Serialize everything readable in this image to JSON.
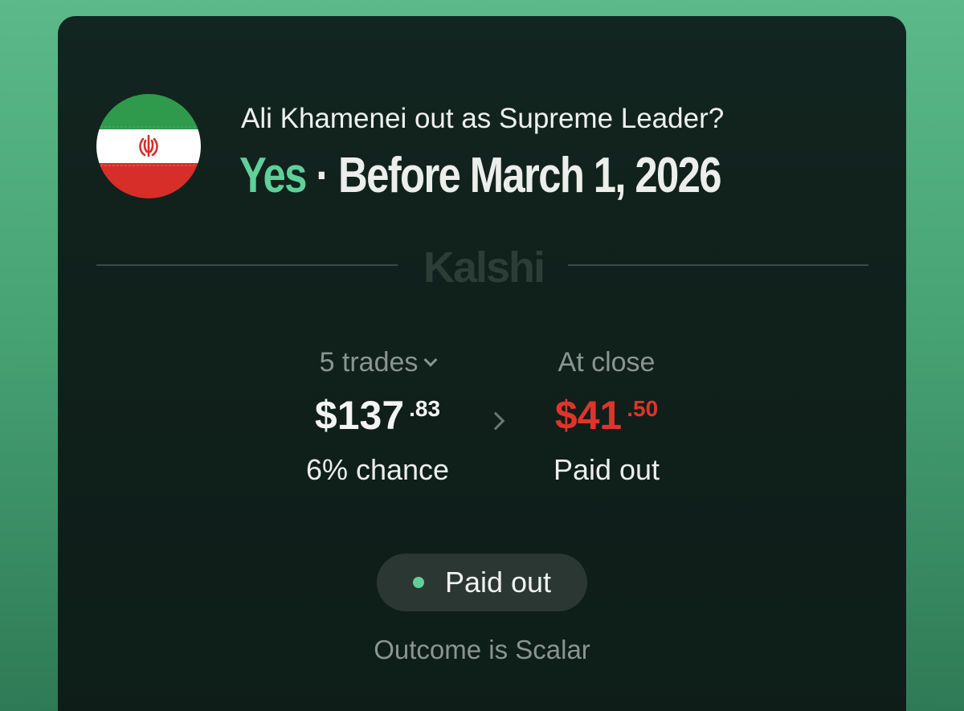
{
  "market": {
    "question": "Ali Khamenei out as Supreme Leader?",
    "side": "Yes",
    "separator": "·",
    "outcome_label": "Before March 1, 2026",
    "flag_icon": "iran-flag-icon"
  },
  "brand": {
    "name": "Kalshi"
  },
  "trades": {
    "label": "5 trades",
    "amount_main": "$137",
    "amount_cents": ".83",
    "chance": "6% chance"
  },
  "close": {
    "label": "At close",
    "amount_main": "$41",
    "amount_cents": ".50",
    "status": "Paid out"
  },
  "status_pill": {
    "text": "Paid out",
    "dot_color": "#5fd09a"
  },
  "footer": {
    "outcome_text": "Outcome is Scalar"
  },
  "colors": {
    "accent_green": "#5fd09a",
    "loss_red": "#e0342a",
    "card_bg": "#10201b",
    "page_bg": "#4cab7b"
  }
}
